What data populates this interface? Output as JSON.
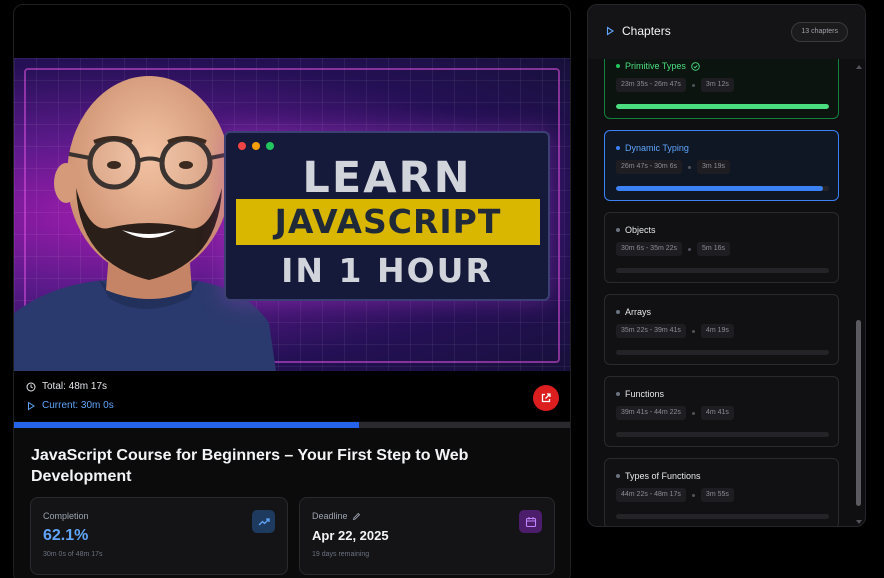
{
  "video": {
    "thumbnail": {
      "line1": "LEARN",
      "line2": "JAVASCRIPT",
      "line3": "IN 1 HOUR"
    },
    "total_label": "Total: 48m 17s",
    "current_label": "Current: 30m 0s",
    "progress_fraction": 0.621,
    "open_external_icon": "external-link-icon"
  },
  "course": {
    "title": "JavaScript Course for Beginners – Your First Step to Web Development"
  },
  "stats": {
    "completion": {
      "label": "Completion",
      "value": "62.1%",
      "sub": "30m 0s of 48m 17s",
      "icon": "trending-up-icon"
    },
    "deadline": {
      "label": "Deadline",
      "value": "Apr 22, 2025",
      "sub": "19 days remaining",
      "icon": "calendar-icon"
    }
  },
  "chapters_panel": {
    "title": "Chapters",
    "count": "13 chapters",
    "items": [
      {
        "name": "Primitive Types",
        "range": "23m 35s - 26m 47s",
        "duration": "3m 12s",
        "status": "done",
        "progress": 1.0
      },
      {
        "name": "Dynamic Typing",
        "range": "26m 47s - 30m 6s",
        "duration": "3m 19s",
        "status": "active",
        "progress": 0.97
      },
      {
        "name": "Objects",
        "range": "30m 6s - 35m 22s",
        "duration": "5m 16s",
        "status": "pending",
        "progress": 0
      },
      {
        "name": "Arrays",
        "range": "35m 22s - 39m 41s",
        "duration": "4m 19s",
        "status": "pending",
        "progress": 0
      },
      {
        "name": "Functions",
        "range": "39m 41s - 44m 22s",
        "duration": "4m 41s",
        "status": "pending",
        "progress": 0
      },
      {
        "name": "Types of Functions",
        "range": "44m 22s - 48m 17s",
        "duration": "3m 55s",
        "status": "pending",
        "progress": 0
      }
    ]
  },
  "colors": {
    "accent_blue": "#3b82f6",
    "done_green": "#4ade80",
    "external_red": "#dc1e1e"
  }
}
